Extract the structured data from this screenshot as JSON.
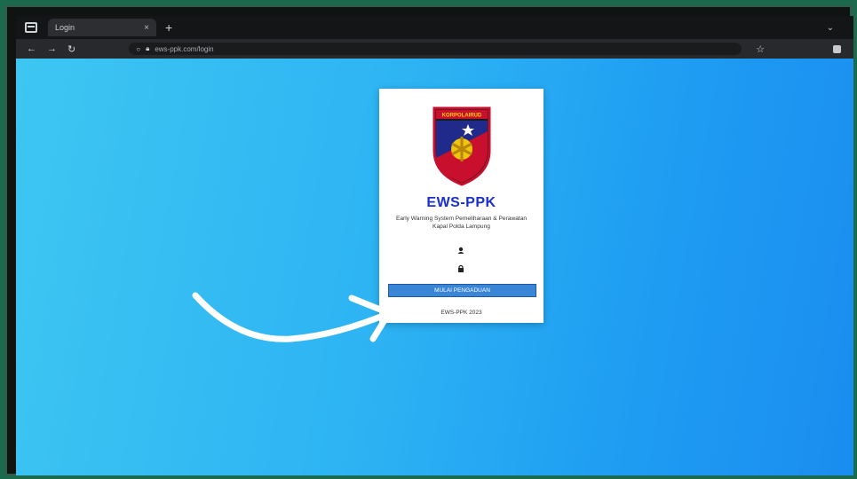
{
  "browser": {
    "tab_title": "Login",
    "tab_close": "×",
    "new_tab": "+",
    "dropdown": "⌄",
    "url": "ews-ppk.com/login"
  },
  "card": {
    "logo_text": "KORPOLAIRUD",
    "title": "EWS-PPK",
    "subtitle": "Early Warning System Pemeliharaan & Perawatan Kapal Polda Lampung",
    "button_label": "MULAI PENGADUAN",
    "footer": "EWS-PPK 2023"
  },
  "colors": {
    "page_gradient_start": "#3ec6f2",
    "page_gradient_end": "#1a8df0",
    "title": "#1a2fd0",
    "button": "#3a86d6"
  },
  "icons": [
    "menu-icon",
    "close-icon",
    "plus-icon",
    "back-icon",
    "forward-icon",
    "reload-icon",
    "info-icon",
    "lock-icon",
    "star-icon",
    "profile-icon",
    "police-emblem",
    "user-icon",
    "password-lock-icon",
    "curved-arrow"
  ]
}
